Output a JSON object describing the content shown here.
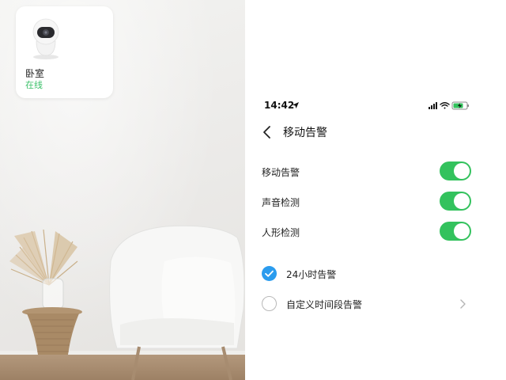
{
  "device_card": {
    "name": "卧室",
    "status": "在线"
  },
  "status_bar": {
    "time": "14:42"
  },
  "nav": {
    "title": "移动告警"
  },
  "toggles": [
    {
      "label": "移动告警",
      "on": true
    },
    {
      "label": "声音检测",
      "on": true
    },
    {
      "label": "人形检测",
      "on": true
    }
  ],
  "schedule_options": [
    {
      "label": "24小时告警",
      "selected": true
    },
    {
      "label": "自定义时间段告警",
      "selected": false
    }
  ],
  "colors": {
    "switch_on": "#33c25d",
    "radio_selected": "#2b9cee",
    "online_status": "#3cc16a"
  },
  "icons": [
    "camera-icon",
    "location-arrow-icon",
    "signal-icon",
    "wifi-icon",
    "battery-charging-icon",
    "back-chevron-icon",
    "check-icon",
    "chevron-right-icon"
  ]
}
